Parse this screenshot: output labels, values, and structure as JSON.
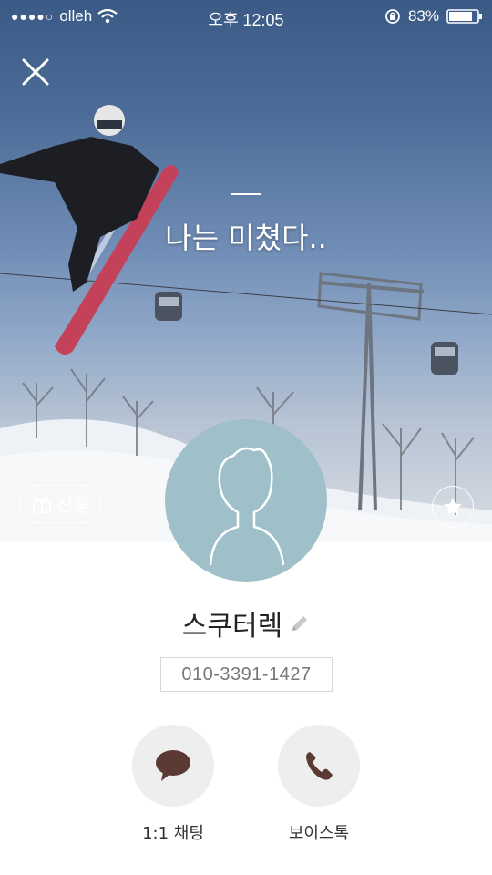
{
  "status_bar": {
    "carrier": "olleh",
    "time": "오후 12:05",
    "battery": "83%"
  },
  "profile": {
    "status_message": "나는 미쳤다..",
    "gift_label": "선물",
    "name": "스쿠터렉",
    "phone": "010-3391-1427"
  },
  "actions": [
    {
      "label": "1:1 채팅",
      "icon": "chat-bubble-icon"
    },
    {
      "label": "보이스톡",
      "icon": "phone-icon"
    }
  ],
  "colors": {
    "avatar_bg": "#9fbfc9",
    "action_bg": "#eeeeee",
    "action_icon": "#5a3a33"
  }
}
